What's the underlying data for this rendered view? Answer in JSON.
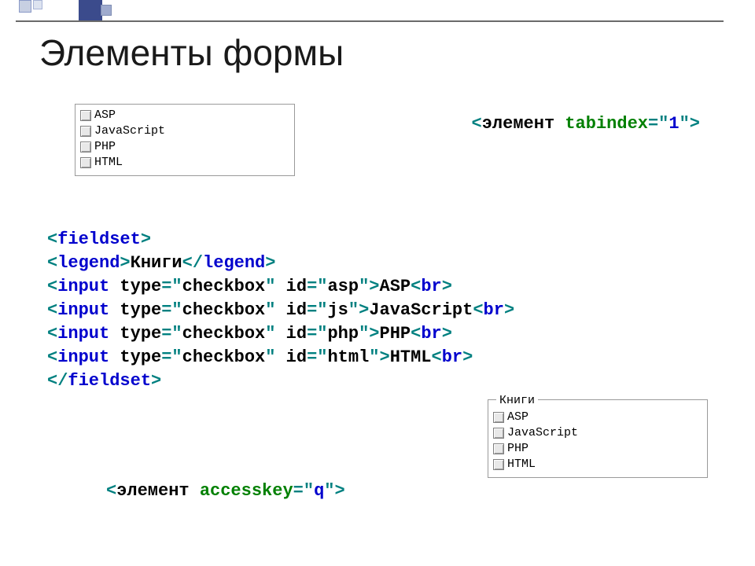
{
  "title": "Элементы формы",
  "checkbox_labels": [
    "ASP",
    "JavaScript",
    "PHP",
    "HTML"
  ],
  "fieldset_legend": "Книги",
  "tabindex_snippet": {
    "ang_open": "<",
    "element": "элемент",
    "sp": " ",
    "attr": "tabindex",
    "eq_q": "=\"",
    "val": "1",
    "q_close": "\">"
  },
  "accesskey_snippet": {
    "ang_open": "<",
    "element": "элемент",
    "sp": " ",
    "attr": "accesskey",
    "eq_q": "=\"",
    "val": "q",
    "q_close": "\">"
  },
  "fieldset_code": {
    "l1_open_ang": "<",
    "l1_tag": "fieldset",
    "l1_close_ang": ">",
    "l2_open_ang": "<",
    "l2_tag": "legend",
    "l2_gt": ">",
    "l2_text": "Книги",
    "l2_close_open": "</",
    "l2_close_gt": ">",
    "input_prefix_open": "<",
    "input_tag": "input",
    "input_sp": " ",
    "input_type_attr": "type",
    "input_eq_q": "=\"",
    "input_type_val": "checkbox",
    "input_q_sp": "\" ",
    "input_id_attr": "id",
    "input_id_eq_q": "=\"",
    "ids": [
      "asp",
      "js",
      "php",
      "html"
    ],
    "input_q_gt": "\">",
    "labels_after": [
      "ASP",
      "JavaScript",
      "PHP",
      "HTML"
    ],
    "br_open": "<",
    "br_tag": "br",
    "br_close": ">",
    "last_open": "</",
    "last_tag": "fieldset",
    "last_close": ">"
  }
}
